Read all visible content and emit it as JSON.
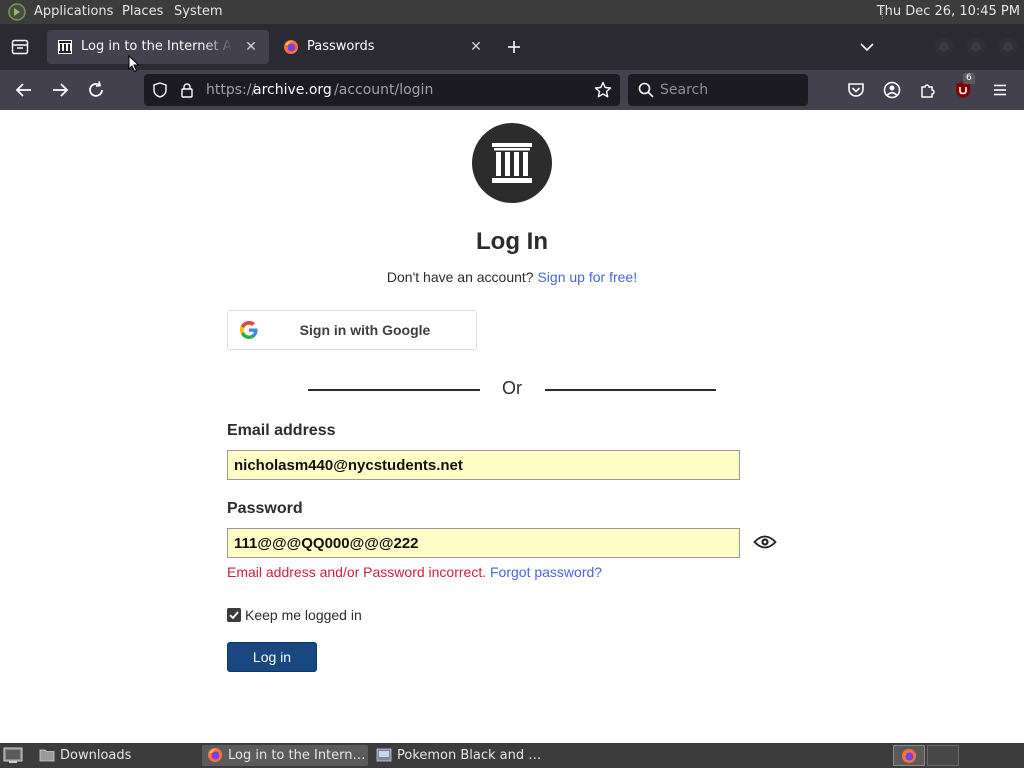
{
  "top_panel": {
    "menus": [
      "Applications",
      "Places",
      "System"
    ],
    "clock": "Thu Dec 26, 10:45 PM"
  },
  "tabs": [
    {
      "title": "Log in to the Internet Archive",
      "active": true
    },
    {
      "title": "Passwords",
      "active": false
    }
  ],
  "navbar": {
    "url_prefix": "https://",
    "url_host": "archive.org",
    "url_path": "/account/login",
    "search_placeholder": "Search",
    "extension_badge": "6"
  },
  "page": {
    "title": "Log In",
    "no_account_text": "Don't have an account?",
    "signup_link": "Sign up for free!",
    "google_button": "Sign in with Google",
    "or_text": "Or",
    "email_label": "Email address",
    "email_value": "nicholasm440@nycstudents.net",
    "password_label": "Password",
    "password_value": "111@@@QQ000@@@222",
    "error_text": "Email address and/or Password incorrect.",
    "forgot_link": "Forgot password?",
    "keep_logged_in": "Keep me logged in",
    "keep_logged_in_checked": true,
    "login_button": "Log in"
  },
  "taskbar": {
    "items": [
      {
        "label": "Downloads",
        "active": false
      },
      {
        "label": "Log in to the Intern…",
        "active": true
      },
      {
        "label": "Pokemon Black and …",
        "active": false
      }
    ]
  },
  "colors": {
    "link": "#4b64de",
    "error": "#d0213a",
    "login_button": "#194880",
    "autofill": "#fffdc6"
  }
}
